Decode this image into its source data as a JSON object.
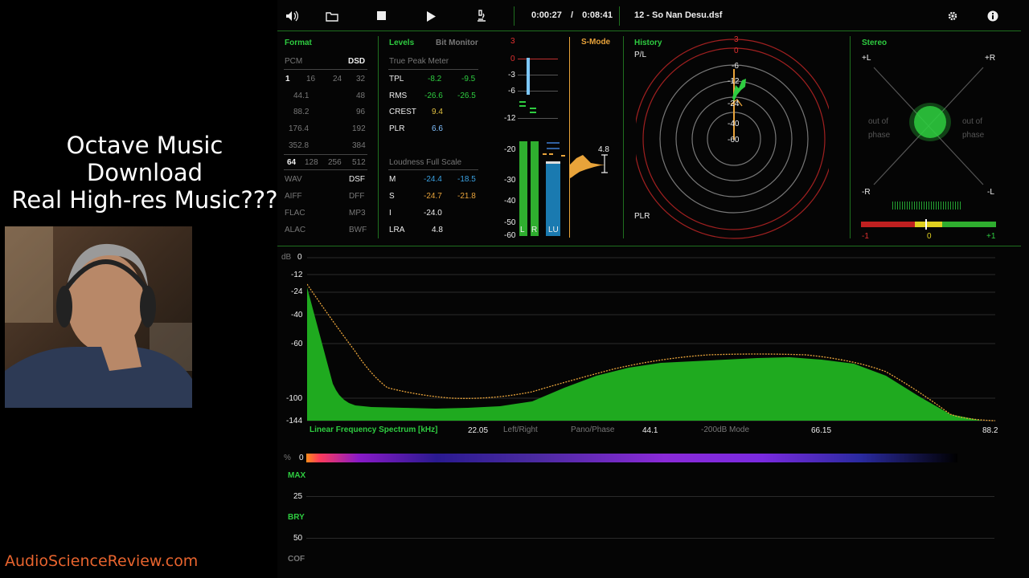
{
  "overlay": {
    "title_line1": "Octave Music Download",
    "title_line2": "Real High-res Music???",
    "watermark": "AudioScienceReview.com"
  },
  "toolbar": {
    "icons": [
      "speaker-icon",
      "folder-icon",
      "stop-icon",
      "play-icon",
      "microscope-icon",
      "gear-icon",
      "info-icon"
    ],
    "time_elapsed": "0:00:27",
    "time_separator": "/",
    "time_total": "0:08:41",
    "filename": "12 - So Nan Desu.dsf"
  },
  "format": {
    "title": "Format",
    "col_pcm": "PCM",
    "col_dsd": "DSD",
    "bits": [
      "1",
      "16",
      "24",
      "32"
    ],
    "rates": [
      [
        "44.1",
        "48"
      ],
      [
        "88.2",
        "96"
      ],
      [
        "176.4",
        "192"
      ],
      [
        "352.8",
        "384"
      ]
    ],
    "dsd_rates": [
      "64",
      "128",
      "256",
      "512"
    ],
    "containers": [
      [
        "WAV",
        "DSF"
      ],
      [
        "AIFF",
        "DFF"
      ],
      [
        "FLAC",
        "MP3"
      ],
      [
        "ALAC",
        "BWF"
      ]
    ]
  },
  "levels": {
    "title": "Levels",
    "bit_monitor": "Bit Monitor",
    "tpm_title": "True Peak Meter",
    "rows": [
      {
        "label": "TPL",
        "l": "-8.2",
        "r": "-9.5"
      },
      {
        "label": "RMS",
        "l": "-26.6",
        "r": "-26.5"
      },
      {
        "label": "CREST",
        "l": "9.4",
        "r": ""
      },
      {
        "label": "PLR",
        "l": "6.6",
        "r": ""
      }
    ],
    "loud_title": "Loudness Full Scale",
    "loud_rows": [
      {
        "label": "M",
        "a": "-24.4",
        "b": "-18.5"
      },
      {
        "label": "S",
        "a": "-24.7",
        "b": "-21.8"
      },
      {
        "label": "I",
        "a": "-24.0",
        "b": ""
      },
      {
        "label": "LRA",
        "a": "4.8",
        "b": ""
      }
    ]
  },
  "meter": {
    "smode": "S-Mode",
    "scale": [
      "3",
      "0",
      "-3",
      "-6",
      "-12",
      "-20",
      "-30",
      "-40",
      "-50",
      "-60"
    ],
    "ch_l": "L",
    "ch_r": "R",
    "ch_lu": "LU",
    "lra_value": "4.8",
    "level_l": 0.53,
    "level_r": 0.53,
    "level_lu": 0.39
  },
  "history": {
    "title": "History",
    "pl": "P/L",
    "plr": "PLR",
    "rings": [
      "3",
      "0",
      "-6",
      "-12",
      "-24",
      "-40",
      "-60"
    ]
  },
  "stereo": {
    "title": "Stereo",
    "tl": "+L",
    "tr": "+R",
    "bl": "-R",
    "br": "-L",
    "out_of_phase": "out of",
    "phase": "phase",
    "corr_labels": [
      "-1",
      "0",
      "+1"
    ]
  },
  "spectrum": {
    "unit": "dB",
    "y_ticks": [
      "0",
      "-12",
      "-24",
      "-40",
      "-60",
      "-100",
      "-144"
    ],
    "x_ticks": [
      "22.05",
      "44.1",
      "66.15",
      "88.2"
    ],
    "mode_label": "Linear Frequency Spectrum [kHz]",
    "modes": [
      "Left/Right",
      "Pano/Phase",
      "-200dB Mode"
    ]
  },
  "bottom": {
    "unit": "%",
    "ticks": [
      "0",
      "25",
      "50"
    ],
    "labels": [
      "MAX",
      "BRY",
      "COF"
    ]
  }
}
